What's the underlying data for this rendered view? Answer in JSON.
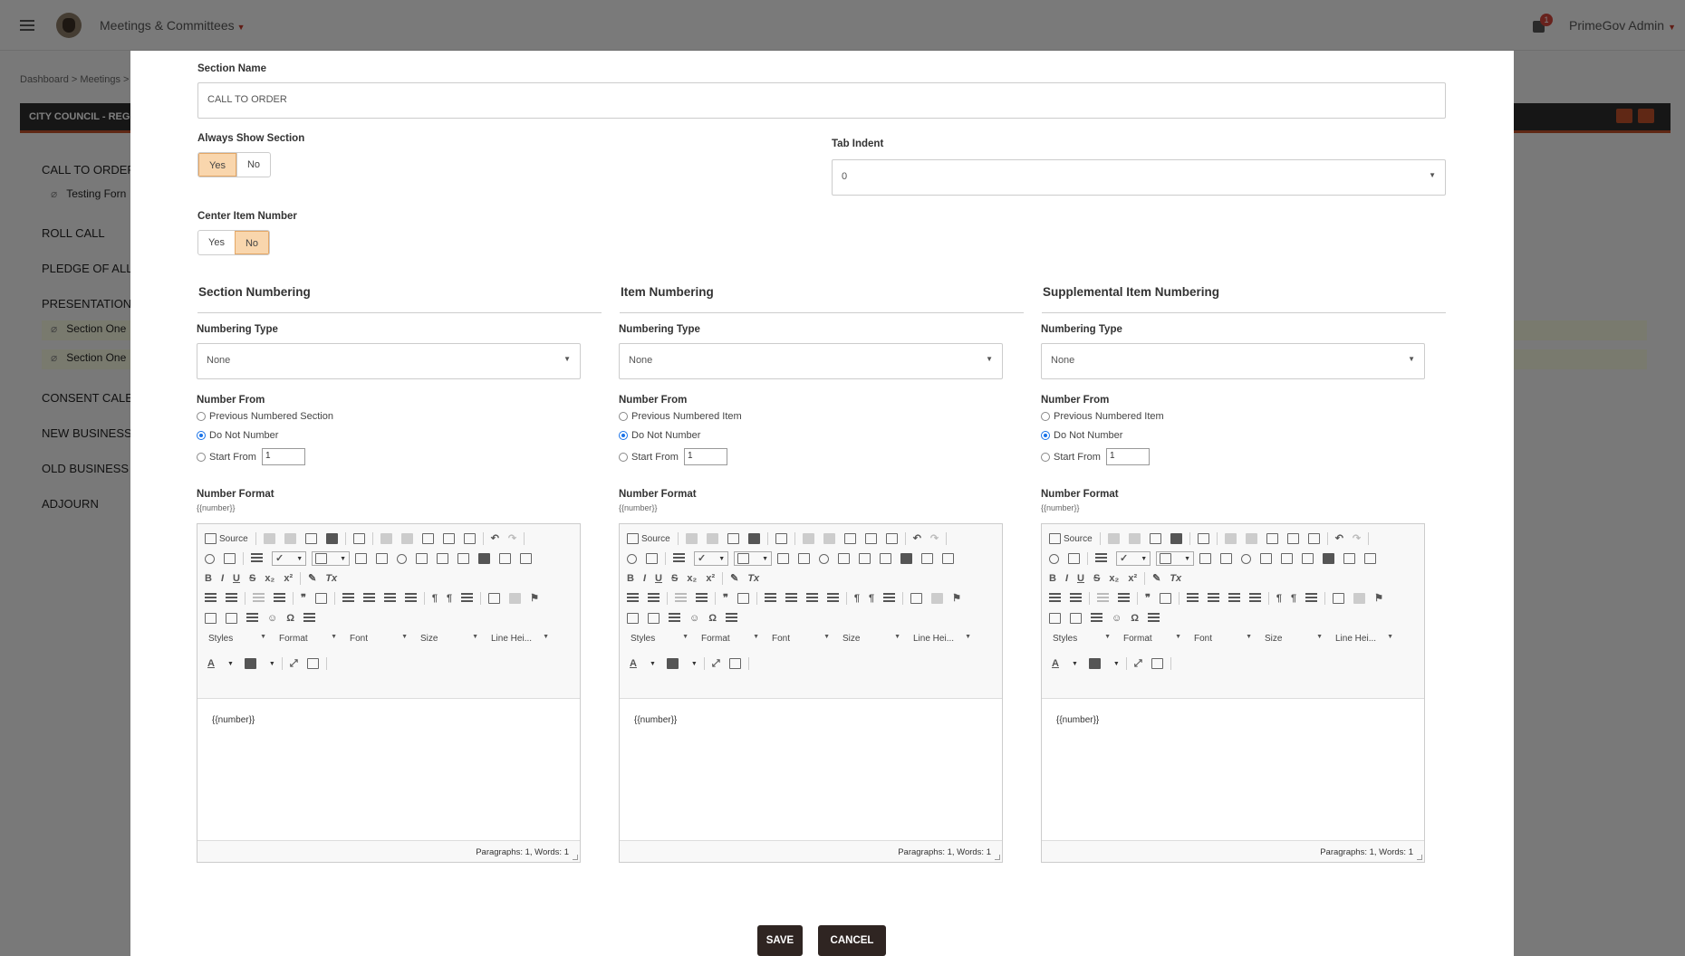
{
  "app": {
    "title": "Meetings & Committees",
    "notification_count": "1",
    "user": "PrimeGov Admin"
  },
  "breadcrumb": "Dashboard > Meetings >",
  "council_bar": "CITY COUNCIL - REGU",
  "agenda": [
    "CALL TO ORDER",
    "Testing Forn",
    "ROLL CALL",
    "PLEDGE OF ALLE",
    "PRESENTATIONS",
    "Section One",
    "Section One",
    "CONSENT CALEN",
    "NEW BUSINESS",
    "OLD BUSINESS",
    "ADJOURN"
  ],
  "modal": {
    "section_name_label": "Section Name",
    "section_name_value": "CALL TO ORDER",
    "always_show_label": "Always Show Section",
    "yes": "Yes",
    "no": "No",
    "tab_indent_label": "Tab Indent",
    "tab_indent_value": "0",
    "center_item_label": "Center Item Number",
    "columns": [
      {
        "title": "Section Numbering",
        "numbering_type_label": "Numbering Type",
        "numbering_type_value": "None",
        "number_from_label": "Number From",
        "options": [
          "Previous Numbered Section",
          "Do Not Number",
          "Start From"
        ],
        "start_value": "1",
        "format_label": "Number Format",
        "format_hint": "{{number}}",
        "editor_content": "{{number}}",
        "status": "Paragraphs: 1, Words: 1"
      },
      {
        "title": "Item Numbering",
        "numbering_type_label": "Numbering Type",
        "numbering_type_value": "None",
        "number_from_label": "Number From",
        "options": [
          "Previous Numbered Item",
          "Do Not Number",
          "Start From"
        ],
        "start_value": "1",
        "format_label": "Number Format",
        "format_hint": "{{number}}",
        "editor_content": "{{number}}",
        "status": "Paragraphs: 1, Words: 1"
      },
      {
        "title": "Supplemental Item Numbering",
        "numbering_type_label": "Numbering Type",
        "numbering_type_value": "None",
        "number_from_label": "Number From",
        "options": [
          "Previous Numbered Item",
          "Do Not Number",
          "Start From"
        ],
        "start_value": "1",
        "format_label": "Number Format",
        "format_hint": "{{number}}",
        "editor_content": "{{number}}",
        "status": "Paragraphs: 1, Words: 1"
      }
    ],
    "toolbar": {
      "source": "Source",
      "styles": "Styles",
      "format": "Format",
      "font": "Font",
      "size": "Size",
      "line_height": "Line Hei..."
    },
    "save": "SAVE",
    "cancel": "CANCEL"
  }
}
